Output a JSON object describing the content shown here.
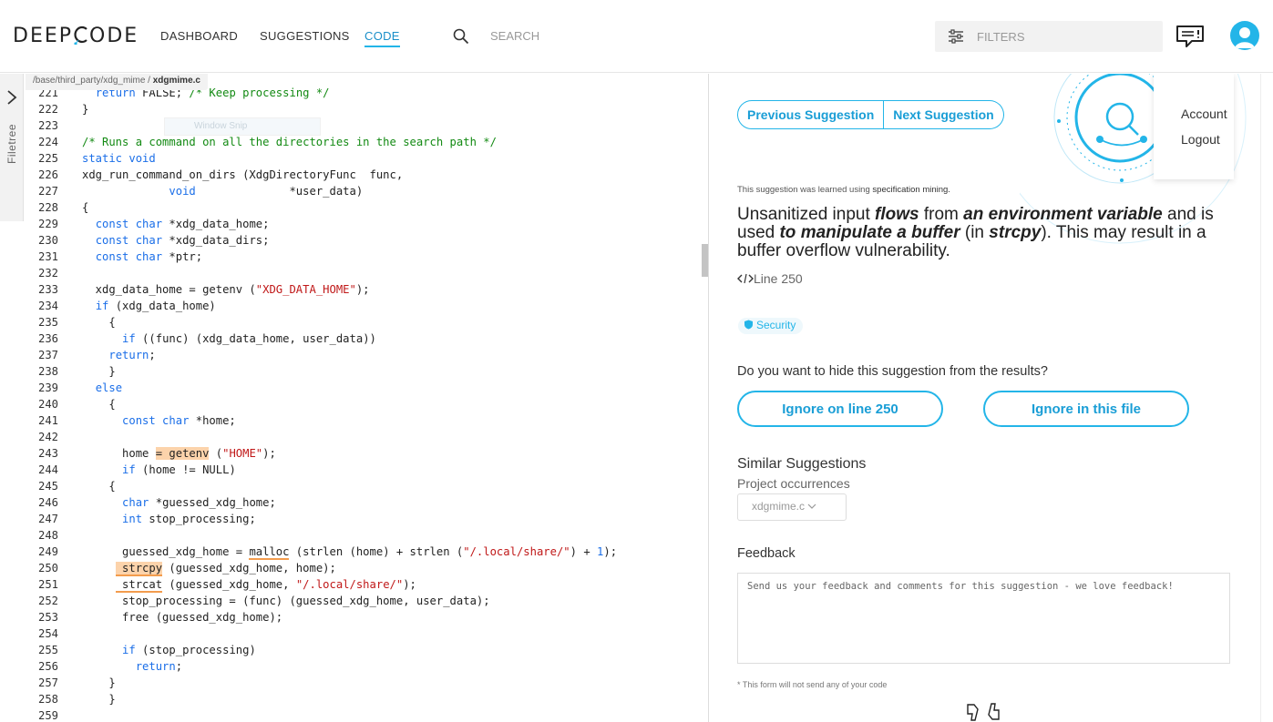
{
  "header": {
    "logo_left": "DEEP",
    "logo_right": "ODE",
    "logo_accent": "#23b5e8",
    "nav": [
      "DASHBOARD",
      "SUGGESTIONS",
      "CODE"
    ],
    "active_nav": "CODE",
    "search_placeholder": "SEARCH",
    "filters_placeholder": "FILTERS",
    "icons": [
      "search-icon",
      "filters-icon",
      "feedback-icon",
      "user-avatar-icon"
    ]
  },
  "filetree": {
    "label": "Filetree"
  },
  "breadcrumb": {
    "path": "/base/third_party/xdg_mime / ",
    "file": "xdgmime.c"
  },
  "ghost_tooltip": "Window Snip",
  "code": {
    "lines": [
      {
        "n": "221",
        "html": "  <span class=\"kw\">return</span> FALSE; <span class=\"cm\">/* Keep processing */</span>"
      },
      {
        "n": "222",
        "html": "}"
      },
      {
        "n": "223",
        "html": ""
      },
      {
        "n": "224",
        "html": "<span class=\"cm\">/* Runs a command on all the directories in the search path */</span>"
      },
      {
        "n": "225",
        "html": "<span class=\"kw\">static void</span>"
      },
      {
        "n": "226",
        "html": "xdg_run_command_on_dirs (XdgDirectoryFunc  func,"
      },
      {
        "n": "227",
        "html": "             <span class=\"kw\">void</span>              *user_data)"
      },
      {
        "n": "228",
        "html": "{"
      },
      {
        "n": "229",
        "html": "  <span class=\"kw\">const char</span> *xdg_data_home;"
      },
      {
        "n": "230",
        "html": "  <span class=\"kw\">const char</span> *xdg_data_dirs;"
      },
      {
        "n": "231",
        "html": "  <span class=\"kw\">const char</span> *ptr;"
      },
      {
        "n": "232",
        "html": ""
      },
      {
        "n": "233",
        "html": "  xdg_data_home = getenv (<span class=\"st\">\"XDG_DATA_HOME\"</span>);"
      },
      {
        "n": "234",
        "html": "  <span class=\"kw\">if</span> (xdg_data_home)"
      },
      {
        "n": "235",
        "html": "    {"
      },
      {
        "n": "236",
        "html": "      <span class=\"kw\">if</span> ((func) (xdg_data_home, user_data))"
      },
      {
        "n": "237",
        "html": "    <span class=\"kw\">return</span>;"
      },
      {
        "n": "238",
        "html": "    }"
      },
      {
        "n": "239",
        "html": "  <span class=\"kw\">else</span>"
      },
      {
        "n": "240",
        "html": "    {"
      },
      {
        "n": "241",
        "html": "      <span class=\"kw\">const char</span> *home;"
      },
      {
        "n": "242",
        "html": ""
      },
      {
        "n": "243",
        "html": "      home <span class=\"hl\">= getenv</span> (<span class=\"st\">\"HOME\"</span>);"
      },
      {
        "n": "244",
        "html": "      <span class=\"kw\">if</span> (home != NULL)"
      },
      {
        "n": "245",
        "html": "    {"
      },
      {
        "n": "246",
        "html": "      <span class=\"kw\">char</span> *guessed_xdg_home;"
      },
      {
        "n": "247",
        "html": "      <span class=\"kw\">int</span> stop_processing;"
      },
      {
        "n": "248",
        "html": ""
      },
      {
        "n": "249",
        "html": "      guessed_xdg_home = <span class=\"ul\">malloc</span> (strlen (home) + strlen (<span class=\"st\">\"/.local/share/\"</span>) + <span class=\"num\">1</span>);"
      },
      {
        "n": "250",
        "html": "     <span class=\"hl ul\"> strcpy</span> (guessed_xdg_home, home);"
      },
      {
        "n": "251",
        "html": "     <span class=\"ul\"> strcat</span> (guessed_xdg_home, <span class=\"st\">\"/.local/share/\"</span>);"
      },
      {
        "n": "252",
        "html": "      stop_processing = (func) (guessed_xdg_home, user_data);"
      },
      {
        "n": "253",
        "html": "      free (guessed_xdg_home);"
      },
      {
        "n": "254",
        "html": ""
      },
      {
        "n": "255",
        "html": "      <span class=\"kw\">if</span> (stop_processing)"
      },
      {
        "n": "256",
        "html": "        <span class=\"kw\">return</span>;"
      },
      {
        "n": "257",
        "html": "    }"
      },
      {
        "n": "258",
        "html": "    }"
      },
      {
        "n": "259",
        "html": ""
      }
    ]
  },
  "suggestion": {
    "prev_label": "Previous Suggestion",
    "next_label": "Next Suggestion",
    "learned_prefix": "This suggestion was learned using ",
    "learned_method": "specification mining.",
    "msg_1": "Unsanitized input ",
    "msg_flows": "flows",
    "msg_2": " from ",
    "msg_env": "an environment variable",
    "msg_3": " and is used ",
    "msg_manip": "to manipulate a buffer",
    "msg_4": " (in ",
    "msg_fn": "strcpy",
    "msg_5": "). This may result in a buffer overflow vulnerability.",
    "line_ref": "Line 250",
    "tag": "Security",
    "hide_question": "Do you want to hide this suggestion from the results?",
    "ignore_line": "Ignore on line 250",
    "ignore_file": "Ignore in this file",
    "similar_title": "Similar Suggestions",
    "project_occ": "Project occurrences",
    "occ_select": "xdgmime.c",
    "feedback_title": "Feedback",
    "feedback_placeholder": "Send us your feedback and comments for this suggestion - we love feedback!",
    "feedback_note": "* This form will not send any of your code"
  },
  "account_menu": {
    "items": [
      "Account",
      "Logout"
    ]
  }
}
